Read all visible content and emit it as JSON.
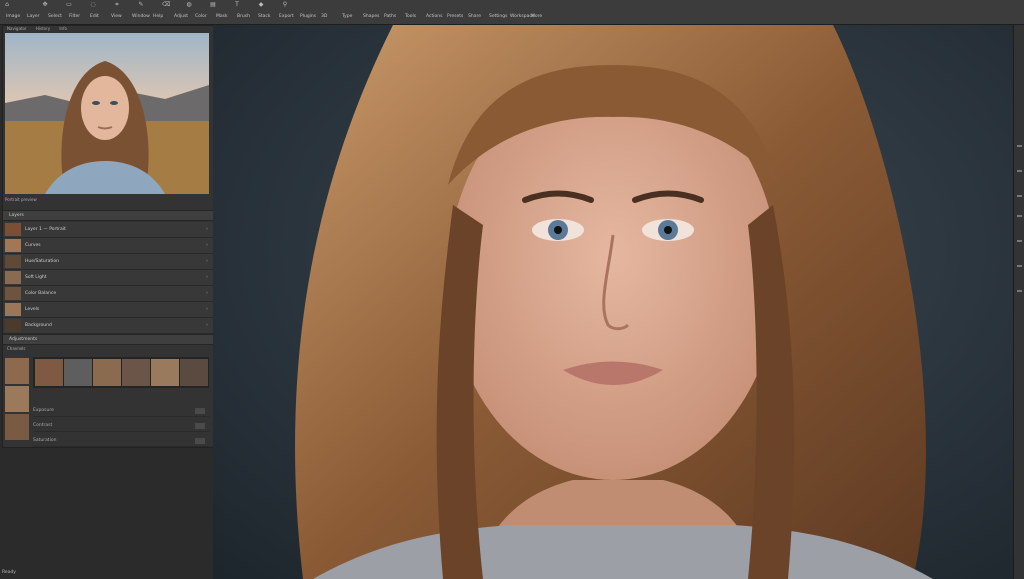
{
  "app": {
    "status_text": "Ready"
  },
  "toolbar": {
    "icons": [
      "home-icon",
      "move-icon",
      "select-icon",
      "lasso-icon",
      "crop-icon",
      "brush-icon",
      "eraser-icon",
      "stamp-icon",
      "gradient-icon",
      "text-icon",
      "shape-icon",
      "zoom-icon"
    ]
  },
  "menu": {
    "items": [
      "Image",
      "Layer",
      "Select",
      "Filter",
      "Edit",
      "View",
      "Window",
      "Help",
      "Adjust",
      "Color",
      "Mask",
      "Brush",
      "Stack",
      "Export",
      "Plugins",
      "3D",
      "Type",
      "Shapes",
      "Paths",
      "Tools",
      "Actions",
      "Presets",
      "Share",
      "Settings",
      "Workspace",
      "More"
    ]
  },
  "left_panel": {
    "tabs": [
      "Navigator",
      "History",
      "Info"
    ],
    "preview_caption": "Portrait preview",
    "layers_title": "Layers",
    "layers": [
      {
        "label": "Layer 1 — Portrait"
      },
      {
        "label": "Curves"
      },
      {
        "label": "Hue/Saturation"
      },
      {
        "label": "Soft Light"
      },
      {
        "label": "Color Balance"
      },
      {
        "label": "Levels"
      },
      {
        "label": "Background"
      }
    ],
    "adjustments_title": "Adjustments",
    "strip_label": "Channels",
    "properties": [
      {
        "label": "Exposure"
      },
      {
        "label": "Contrast"
      },
      {
        "label": "Saturation"
      }
    ]
  },
  "colors": {
    "canvas_bg": "#263038",
    "panel_bg": "#333333",
    "topbar_bg": "#3c3c3c"
  }
}
